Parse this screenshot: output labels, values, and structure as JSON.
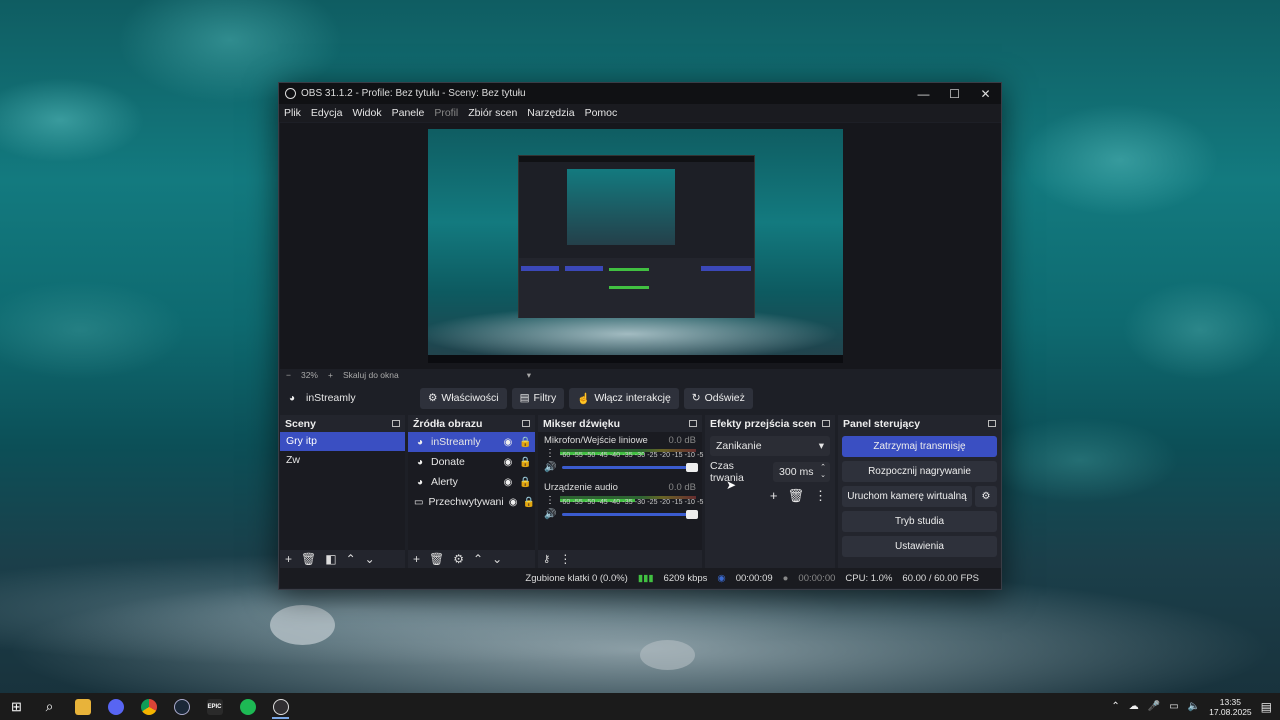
{
  "window": {
    "title": "OBS 31.1.2 - Profile: Bez tytułu - Sceny: Bez tytułu",
    "min": "—",
    "max": "☐",
    "close": "✕"
  },
  "menu": [
    "Plik",
    "Edycja",
    "Widok",
    "Panele",
    "Profil",
    "Zbiór scen",
    "Narzędzia",
    "Pomoc"
  ],
  "zoom": {
    "minus": "−",
    "value": "32%",
    "plus": "+",
    "fit": "Skaluj do okna",
    "arrow": "▾"
  },
  "context": {
    "source": "inStreamly",
    "properties": "Właściwości",
    "filters": "Filtry",
    "interact": "Włącz interakcję",
    "refresh": "Odśwież"
  },
  "scenes": {
    "title": "Sceny",
    "items": [
      "Gry itp",
      "Zw"
    ]
  },
  "sources": {
    "title": "Źródła obrazu",
    "items": [
      "inStreamly",
      "Donate",
      "Alerty",
      "Przechwytywani"
    ]
  },
  "mixer": {
    "title": "Mikser dźwięku",
    "channels": [
      {
        "name": "Mikrofon/Wejście liniowe",
        "db": "0.0 dB",
        "level": 0.62
      },
      {
        "name": "Urządzenie audio",
        "db": "0.0 dB",
        "level": 0.55
      }
    ],
    "scale": "-60 -55 -50 -45 -40 -35 -30 -25 -20 -15 -10 -5 0"
  },
  "transitions": {
    "title": "Efekty przejścia scen",
    "selected": "Zanikanie",
    "duration_label": "Czas trwania",
    "duration_value": "300 ms"
  },
  "controls": {
    "title": "Panel sterujący",
    "stop_stream": "Zatrzymaj transmisję",
    "start_record": "Rozpocznij nagrywanie",
    "virtual_cam": "Uruchom kamerę wirtualną",
    "studio": "Tryb studia",
    "settings": "Ustawienia"
  },
  "status": {
    "dropped": "Zgubione klatki 0 (0.0%)",
    "bitrate": "6209 kbps",
    "stream_time": "00:00:09",
    "rec_time": "00:00:00",
    "cpu": "CPU: 1.0%",
    "fps": "60.00 / 60.00 FPS"
  },
  "taskbar": {
    "time": "13:35",
    "date": "17.08.2025",
    "apps": [
      "windows",
      "search",
      "explorer",
      "discord",
      "chrome",
      "steam",
      "epic",
      "spotify",
      "obs"
    ],
    "epic_label": "EPIC"
  },
  "colors": {
    "accent": "#3a4fc2",
    "panel": "#23252d",
    "background": "#1d1f26"
  }
}
